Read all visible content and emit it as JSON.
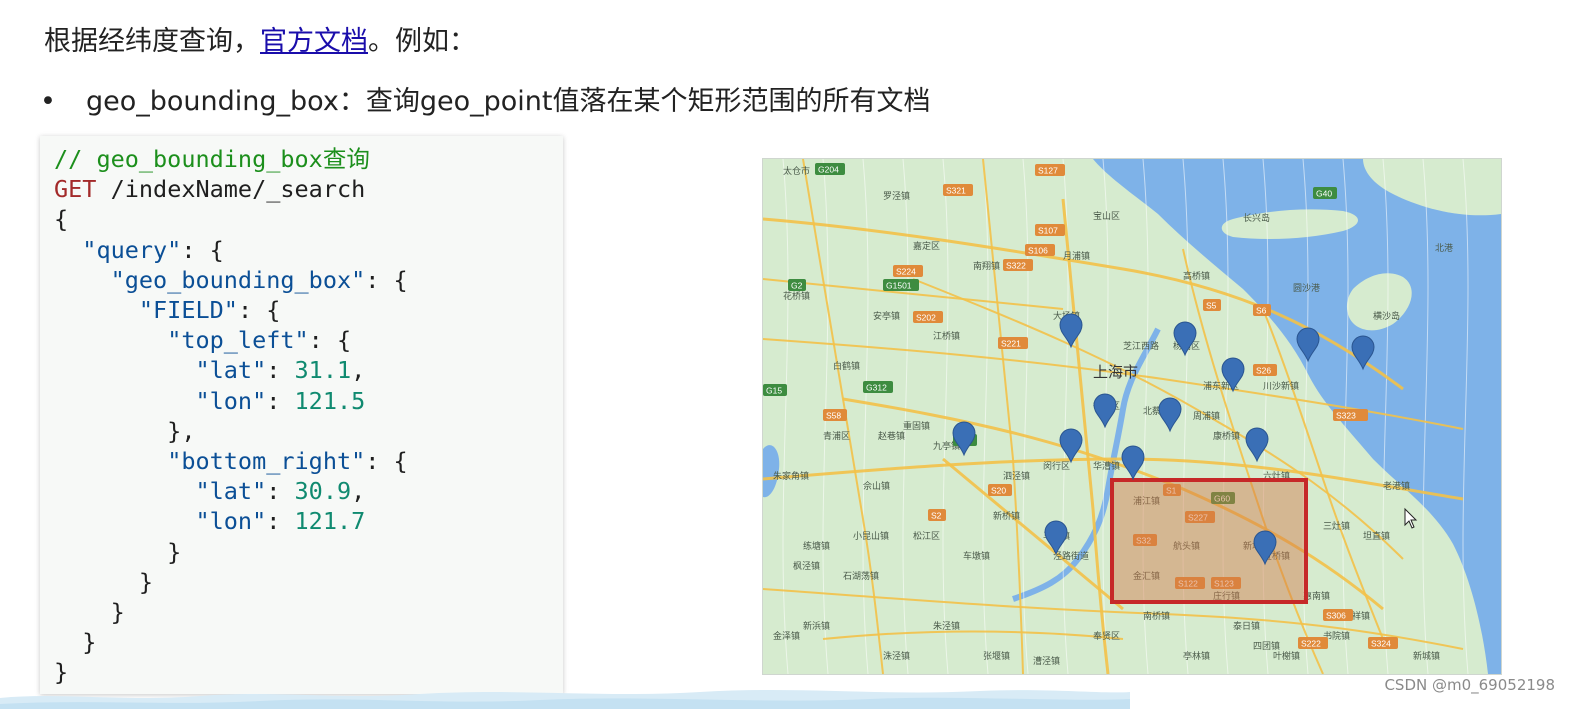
{
  "intro": {
    "text_before": "根据经纬度查询，",
    "link": "官方文档",
    "text_after": "。例如："
  },
  "bullet": {
    "marker": "•",
    "text": "geo_bounding_box：查询geo_point值落在某个矩形范围的所有文档"
  },
  "code": {
    "comment": "// geo_bounding_box查询",
    "method": "GET",
    "path": " /indexName/_search",
    "key_query": "\"query\"",
    "key_geo_bounding_box": "\"geo_bounding_box\"",
    "key_field": "\"FIELD\"",
    "key_top_left": "\"top_left\"",
    "key_bottom_right": "\"bottom_right\"",
    "key_lat": "\"lat\"",
    "key_lon": "\"lon\"",
    "top_left": {
      "lat": "31.1",
      "lon": "121.5"
    },
    "bottom_right": {
      "lat": "30.9",
      "lon": "121.7"
    }
  },
  "map": {
    "city_label": "上海市",
    "place_labels": [
      "太仓市",
      "长兴岛",
      "北港",
      "横沙岛",
      "圆沙港",
      "宝山区",
      "嘉定区",
      "罗泾镇",
      "月浦镇",
      "高桥镇",
      "花桥镇",
      "安亭镇",
      "南翔镇",
      "江桥镇",
      "大场镇",
      "芝江西路",
      "杨浦区",
      "浦东新区",
      "徐汇区",
      "北蔡镇",
      "闵行区",
      "华漕镇",
      "九亭镇",
      "泗泾镇",
      "松江区",
      "新桥镇",
      "青浦区",
      "重固镇",
      "白鹤镇",
      "赵巷镇",
      "朱家角镇",
      "佘山镇",
      "车墩镇",
      "马桥镇",
      "泾路街道",
      "周浦镇",
      "康桥镇",
      "川沙新镇",
      "六灶镇",
      "浦江镇",
      "航头镇",
      "新场镇",
      "宣桥镇",
      "惠南镇",
      "三灶镇",
      "老港镇",
      "坦直镇",
      "万祥镇",
      "书院镇",
      "新城镇",
      "奉贤区",
      "南桥镇",
      "泰日镇",
      "四团镇",
      "金汇镇",
      "庄行镇",
      "亭林镇",
      "叶榭镇",
      "张堰镇",
      "漕泾镇",
      "新浜镇",
      "枫泾镇",
      "洙泾镇",
      "石湖荡镇",
      "小昆山镇",
      "练塘镇",
      "金泽镇",
      "朱泾镇"
    ],
    "road_labels": [
      "G204",
      "S321",
      "S127",
      "G40",
      "S107",
      "S106",
      "S224",
      "G1501",
      "S322",
      "S5",
      "S6",
      "S202",
      "S221",
      "G15",
      "G312",
      "S58",
      "S26",
      "S125",
      "G50",
      "S20",
      "S1",
      "G60",
      "S227",
      "S32",
      "S122",
      "S123",
      "S306",
      "S324",
      "S2",
      "S222",
      "S323",
      "G2"
    ],
    "pin_count": 13,
    "query_box": {
      "lat_top": 31.1,
      "lon_left": 121.5,
      "lat_bottom": 30.9,
      "lon_right": 121.7
    },
    "box_color": "#c62828",
    "land_color": "#d6ebcf",
    "water_color": "#7eb2e8",
    "road_color": "#f3c148",
    "pin_color": "#3a6fb6"
  },
  "watermark": "CSDN @m0_69052198"
}
